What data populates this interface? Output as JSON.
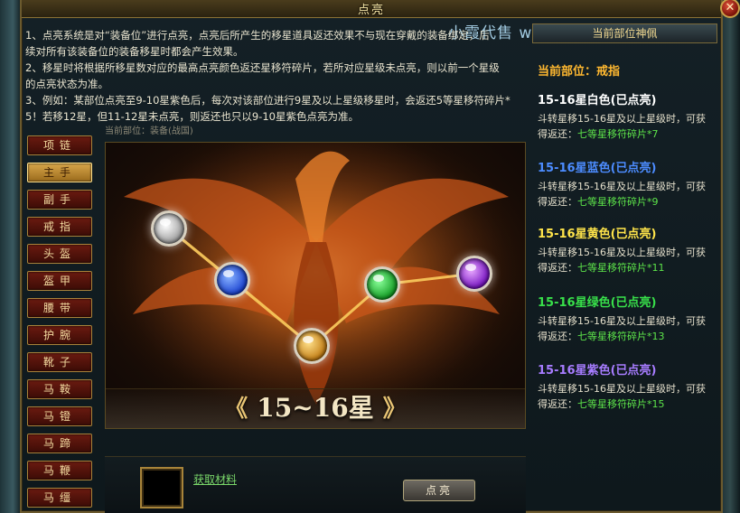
{
  "dialog": {
    "title": "点亮",
    "close_label": "✕"
  },
  "watermark": "小霞代售 www.xx",
  "instructions": [
    "1、点亮系统是对“装备位”进行点亮，点亮后所产生的移星道具返还效果不与现在穿戴的装备绑定，后",
    "续对所有该装备位的装备移星时都会产生效果。",
    "2、移星时将根据所移星数对应的最高点亮颜色返还星移符碎片，若所对应星级未点亮，则以前一个星级",
    "的点亮状态为准。",
    "3、例如：某部位点亮至9-10星紫色后，每次对该部位进行9星及以上星级移星时，会返还5等星移符碎片*",
    "5！若移12星，但11-12星未点亮，则返还也只以9-10星紫色点亮为准。"
  ],
  "stage_subtitle": "当前部位：装备(战国)",
  "slots": [
    {
      "label": "项链",
      "active": false
    },
    {
      "label": "主手",
      "active": true
    },
    {
      "label": "副手",
      "active": false
    },
    {
      "label": "戒指",
      "active": false
    },
    {
      "label": "头盔",
      "active": false
    },
    {
      "label": "盔甲",
      "active": false
    },
    {
      "label": "腰带",
      "active": false
    },
    {
      "label": "护腕",
      "active": false
    },
    {
      "label": "靴子",
      "active": false
    },
    {
      "label": "马鞍",
      "active": false
    },
    {
      "label": "马镫",
      "active": false
    },
    {
      "label": "马蹄",
      "active": false
    },
    {
      "label": "马鞭",
      "active": false
    },
    {
      "label": "马缰",
      "active": false
    }
  ],
  "stage": {
    "star_range_label": "15~16星",
    "left_arrow": "《",
    "right_arrow": "》",
    "orbs": [
      {
        "name": "white",
        "color": "#f2f2f2"
      },
      {
        "name": "blue",
        "color": "#2a6cff"
      },
      {
        "name": "yellow",
        "color": "#f0b628"
      },
      {
        "name": "green",
        "color": "#2ad838"
      },
      {
        "name": "purple",
        "color": "#b13cf0"
      }
    ]
  },
  "right_panel": {
    "header": "当前部位神佩",
    "current_slot": "当前部位：戒指",
    "tiers": [
      {
        "title": "15-16星白色(已点亮)",
        "color": "#ffffff",
        "line1": "斗转星移15-16星及以上星级时，可获",
        "line2_prefix": "得返还：",
        "reward": "七等星移符碎片*7"
      },
      {
        "title": "15-16星蓝色(已点亮)",
        "color": "#4c8cff",
        "line1": "斗转星移15-16星及以上星级时，可获",
        "line2_prefix": "得返还：",
        "reward": "七等星移符碎片*9"
      },
      {
        "title": "15-16星黄色(已点亮)",
        "color": "#ffe44a",
        "line1": "斗转星移15-16星及以上星级时，可获",
        "line2_prefix": "得返还：",
        "reward": "七等星移符碎片*11"
      },
      {
        "title": "15-16星绿色(已点亮)",
        "color": "#38e04a",
        "line1": "斗转星移15-16星及以上星级时，可获",
        "line2_prefix": "得返还：",
        "reward": "七等星移符碎片*13"
      },
      {
        "title": "15-16星紫色(已点亮)",
        "color": "#a77cff",
        "line1": "斗转星移15-16星及以上星级时，可获",
        "line2_prefix": "得返还：",
        "reward": "七等星移符碎片*15"
      }
    ]
  },
  "bottom": {
    "get_material_label": "获取材料",
    "light_button_label": "点亮"
  }
}
